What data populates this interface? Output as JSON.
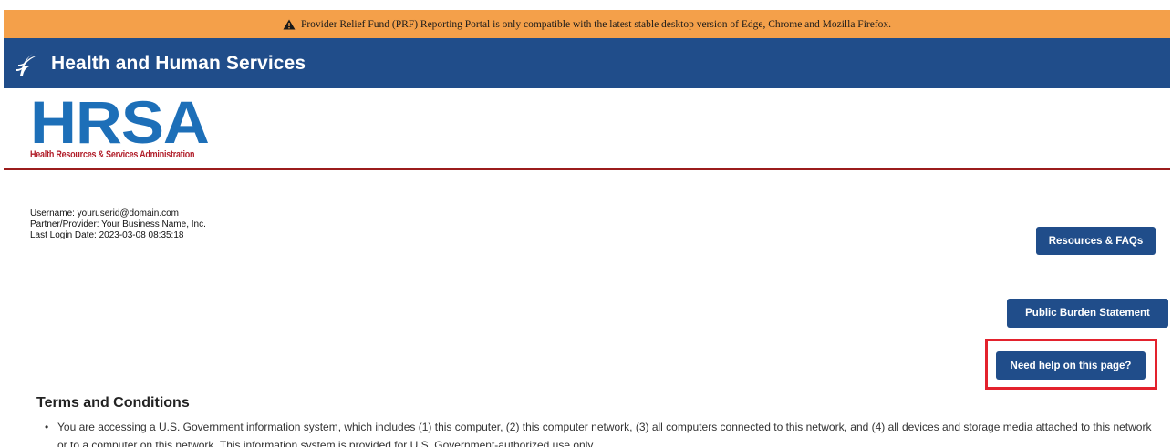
{
  "banner": {
    "warning_text": "Provider Relief Fund (PRF) Reporting Portal is only compatible with the latest stable desktop version of Edge, Chrome and Mozilla Firefox.",
    "color": "#f4a04a"
  },
  "header": {
    "title": "Health and Human Services",
    "color": "#204d8a"
  },
  "logo": {
    "wordmark": "HRSA",
    "subtitle": "Health Resources & Services Administration",
    "wordmark_color": "#1d6fb8",
    "subtitle_color": "#b11e2a"
  },
  "user": {
    "username_line": "Username: youruserid@domain.com",
    "partner_line": "Partner/Provider: Your Business Name, Inc.",
    "last_login_line": "Last Login Date: 2023-03-08 08:35:18"
  },
  "buttons": {
    "resources": "Resources & FAQs",
    "burden": "Public Burden Statement",
    "help": "Need help on this page?"
  },
  "terms": {
    "title": "Terms and Conditions",
    "items": [
      "You are accessing a U.S. Government information system, which includes (1) this computer, (2) this computer network, (3) all computers connected to this network, and (4) all devices and storage media attached to this network or to a computer on this network. This information system is provided for U.S. Government-authorized use only."
    ]
  },
  "icons": {
    "warning": "warning-triangle-icon",
    "hhs_logo": "hhs-eagle-icon"
  },
  "highlight_color": "#e3222d"
}
